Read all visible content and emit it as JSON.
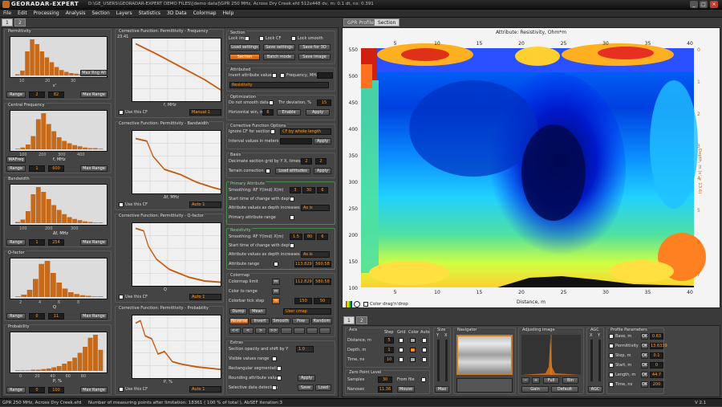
{
  "window": {
    "app_name": "GEORADAR-EXPERT",
    "title_path": "D:\\GE_USERS\\GEORADAR-EXPERT DEMO FILES\\[demo data]\\GPR 250 MHz, Across Dry Creek.efd   512x448   dv, m: 0.1   dt, ns: 0.391"
  },
  "menu": [
    "File",
    "Edit",
    "Processing",
    "Analysis",
    "Section",
    "Layers",
    "Statistics",
    "3D Data",
    "Colormap",
    "Help"
  ],
  "left_tabs": [
    "1",
    "2"
  ],
  "attributes": [
    {
      "title": "Permittivity",
      "xlabel": "ε'",
      "ticks": [
        "10",
        "20",
        "30"
      ],
      "range_label": "Range",
      "from": "2",
      "to": "82",
      "maxrange_label": "Max Range",
      "extra": "Max Rng All"
    },
    {
      "title": "Central Frequency",
      "xlabel": "f, MHz",
      "ticks": [
        "100",
        "200",
        "300",
        "400"
      ],
      "range_label": "Range",
      "from": "1",
      "to": "600",
      "maxrange_label": "Max Range",
      "extra": "WAFreq"
    },
    {
      "title": "Bandwidth",
      "xlabel": "Δf, MHz",
      "ticks": [
        "100",
        "200",
        "300"
      ],
      "range_label": "Range",
      "from": "1",
      "to": "254",
      "maxrange_label": "Max Range",
      "extra": ""
    },
    {
      "title": "Q-factor",
      "xlabel": "Q",
      "ticks": [
        "2",
        "4",
        "6",
        "8"
      ],
      "range_label": "Range",
      "from": "0",
      "to": "11",
      "maxrange_label": "Max Range",
      "extra": ""
    },
    {
      "title": "Probability",
      "xlabel": "P, %",
      "ticks": [
        "0",
        "20",
        "40",
        "60",
        "80"
      ],
      "range_label": "Range",
      "from": "0",
      "to": "100",
      "maxrange_label": "Max Range",
      "extra": ""
    }
  ],
  "cf_panels": [
    {
      "title": "Corrective Function: Permittivity - Frequency",
      "xlabel": "f, MHz",
      "top_value": "23.41",
      "use_label": "Use this CF",
      "mode": "Manual 1"
    },
    {
      "title": "Corrective Function: Permittivity - Bandwidth",
      "xlabel": "Δf, MHz",
      "use_label": "Use this CF",
      "mode": "Auto 1"
    },
    {
      "title": "Corrective Function: Permittivity - Q-factor",
      "xlabel": "Q",
      "use_label": "Use this CF",
      "mode": "Auto 1"
    },
    {
      "title": "Corrective Function: Permittivity - Probability",
      "xlabel": "P, %",
      "use_label": "Use this CF",
      "mode": "Auto 1"
    }
  ],
  "section_panel": {
    "title": "Section",
    "lock_img": "Lock img",
    "lock_cf": "Lock CF",
    "lock_smooth": "Lock smooth",
    "load_settings": "Load settings",
    "save_settings": "Save settings",
    "save_3d": "Save for 3D",
    "section_btn": "Section",
    "batch_btn": "Batch mode",
    "save_image": "Save image",
    "attributed_title": "Attributed",
    "invert_label": "Invert attribute values",
    "frequency_label": "Frequency, MHz",
    "attribute_select": "Resistivity",
    "opt_title": "Optimization",
    "no_smooth": "Do not smooth data",
    "thr_label": "Thr deviation, %",
    "thr_value": "15",
    "hwin_label": "Horizontal win, m",
    "hwin_value": "6",
    "enable": "Enable",
    "apply": "Apply",
    "cfo_title": "Corrective Function Options",
    "ignore_cf": "Ignore CF for section",
    "cf_by": "CF by whole length",
    "interval_label": "Interval values in meters",
    "apply2": "Apply",
    "basis_title": "Basis",
    "decimate": "Decimate section grid by Y X, times",
    "dec_y": "2",
    "dec_x": "2",
    "terrain": "Terrain correction",
    "load_alt": "Load altitudes",
    "apply3": "Apply",
    "primary_title": "Primary Attribute",
    "smoothing_label": "Smoothing: RF Y(lmd) X(m)",
    "p_s1": "3",
    "p_s2": "30",
    "p_s3": "6",
    "start_time": "Start time of change with depth",
    "attr_depth": "Attribute values as depth increases",
    "as_is": "As is",
    "attr_range": "Primary attribute range",
    "res_title": "Resistivity",
    "r_s1": "1.5",
    "r_s2": "80",
    "r_s3": "6",
    "r_start": "Start time of change with depth",
    "r_depth": "Attribute values as depth increases",
    "r_as_is": "As is",
    "r_range": "Attribute range",
    "r_min": "113.829",
    "r_max": "560.58",
    "cmap_title": "Colormap",
    "cmap_limit": "Colormap limit",
    "cl_min": "112.829",
    "cl_max": "580.58",
    "color_range": "Color to range",
    "tick_step": "Colorbar tick step",
    "step_val": "150",
    "step_val2": "50",
    "dump": "Dump",
    "mean": "Mean",
    "user_cmap": "User cmap",
    "reverse": "Reverse",
    "invert": "Invert",
    "smooth": "Smooth",
    "pow": "Pow",
    "random": "Random",
    "arrows": [
      "<<",
      "<",
      ">",
      ">>",
      "",
      "",
      "",
      ""
    ],
    "extras_title": "Extras",
    "opacity": "Section opacity and shift by Y",
    "opacity_val": "1.0",
    "vis_range": "Visible values range",
    "rect_seg": "Rectangular segmentation",
    "round_vals": "Rounding attribute values",
    "apply4": "Apply",
    "sel_detect": "Selective data detection",
    "save": "Save",
    "load": "Load"
  },
  "right_tabs": [
    "GPR Profile",
    "Section"
  ],
  "map": {
    "title": "Attribute: Resistivity, Ohm*m",
    "xlabel": "Distance, m",
    "ylabel": "Depth, m (ε' = 13.6)",
    "x_ticks": [
      "5",
      "10",
      "15",
      "20",
      "25",
      "30",
      "35",
      "40"
    ],
    "y_ticks": [
      "550",
      "500",
      "450",
      "400",
      "350",
      "300",
      "250",
      "200",
      "150",
      "100"
    ],
    "depth_ticks": [
      "0",
      "1",
      "2",
      "3",
      "4",
      "5",
      "6",
      "7"
    ],
    "color_dragdrop": "Color drag'n'drop"
  },
  "bottom_tabs": [
    "1",
    "2"
  ],
  "axis_panel": {
    "title": "Axis",
    "step": "Step",
    "grid": "Grid",
    "color": "Color",
    "auto": "Auto",
    "distance": "Distance, m",
    "depth": "Depth, m",
    "time": "Time, ns",
    "dist_step": "5",
    "depth_step": "1",
    "time_step": "10",
    "zero_title": "Zero Point Level",
    "samples": "Samples",
    "samples_val": "30",
    "from_file": "From file",
    "nanosec": "Nanosec",
    "nanosec_val": "11.36",
    "mouse": "Mouse"
  },
  "size_panel": {
    "title": "Size",
    "y": "Y",
    "x": "X",
    "max": "Max"
  },
  "navigator": {
    "title": "Navigator"
  },
  "adjusting": {
    "title": "Adjusting image",
    "gain": "Gain",
    "default": "Default",
    "full": "Full",
    "bin": "Bin"
  },
  "agc": {
    "title": "AGC",
    "agc": "AGC",
    "x": "X",
    "y": "Y"
  },
  "profile_params": {
    "title": "Profile Parameters",
    "rows": [
      {
        "label": "Base, m",
        "val": "0.63"
      },
      {
        "label": "Permittivity",
        "val": "13.6339"
      },
      {
        "label": "Step, m",
        "val": "0.1"
      },
      {
        "label": "Start, m",
        "val": "0"
      },
      {
        "label": "Length, m",
        "val": "44.7"
      },
      {
        "label": "Time, ns",
        "val": "200"
      }
    ],
    "ok": "OK"
  },
  "status": {
    "left": "GPR 250 MHz, Across Dry Creek.efd",
    "mid": "Number of measuring points after limitation: 18361  ( 100 % of total ), AbSEF iteration:3",
    "version": "V 2.1"
  }
}
